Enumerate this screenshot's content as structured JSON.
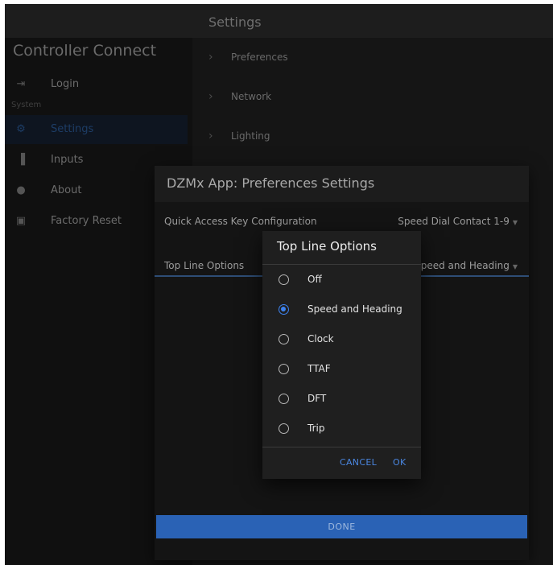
{
  "header": {
    "title": "Settings"
  },
  "sidebar": {
    "brand": "Controller Connect",
    "section": "System",
    "items": [
      {
        "label": "Login",
        "icon": "login-icon"
      },
      {
        "label": "Settings",
        "icon": "gear-icon",
        "active": true
      },
      {
        "label": "Inputs",
        "icon": "sliders-icon"
      },
      {
        "label": "About",
        "icon": "info-icon"
      },
      {
        "label": "Factory Reset",
        "icon": "reset-icon"
      }
    ]
  },
  "accordion": [
    {
      "label": "Preferences"
    },
    {
      "label": "Network"
    },
    {
      "label": "Lighting"
    }
  ],
  "settings_dialog": {
    "title": "DZMx App: Preferences Settings",
    "rows": [
      {
        "label": "Quick Access Key Configuration",
        "value": "Speed Dial Contact 1-9"
      },
      {
        "label": "Top Line Options",
        "value": "Speed and Heading"
      }
    ],
    "done_label": "DONE"
  },
  "options_dialog": {
    "title": "Top Line Options",
    "options": [
      "Off",
      "Speed and Heading",
      "Clock",
      "TTAF",
      "DFT",
      "Trip"
    ],
    "selected": "Speed and Heading",
    "cancel_label": "CANCEL",
    "ok_label": "OK"
  },
  "colors": {
    "accent": "#3d82ee",
    "done_bar": "#2a62b5"
  }
}
